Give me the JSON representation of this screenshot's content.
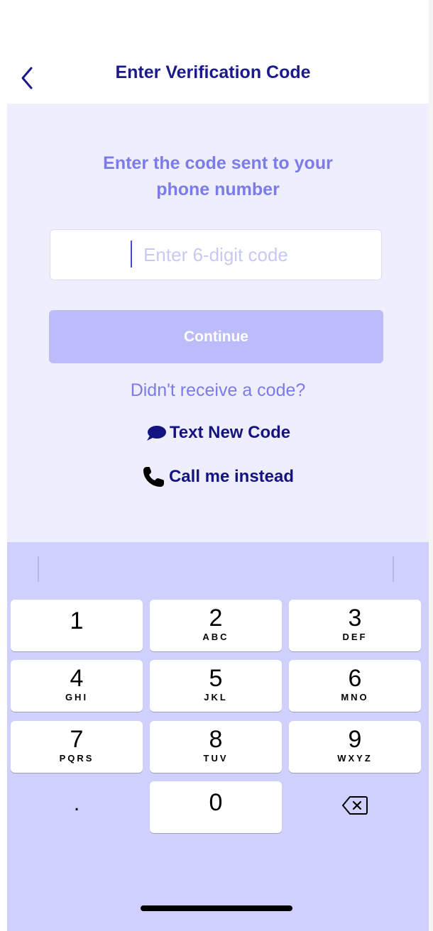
{
  "header": {
    "title": "Enter Verification Code",
    "back_icon": "chevron-left-icon"
  },
  "colors": {
    "title": "#1a1a8c",
    "accent_light": "#7b7bea",
    "content_bg": "#eeeefc",
    "button_disabled": "#bcbcfa",
    "keyboard_bg": "#d0d0fc",
    "link": "#141480"
  },
  "main": {
    "prompt_line1": "Enter the code sent to your",
    "prompt_line2": "phone number",
    "code_input": {
      "placeholder": "Enter 6-digit code",
      "value": ""
    },
    "continue_label": "Continue",
    "no_code_text": "Didn't receive a code?",
    "text_new_code": {
      "label": "Text New Code",
      "icon": "chat-bubble-icon"
    },
    "call_me": {
      "label": "Call me instead",
      "icon": "phone-icon"
    }
  },
  "keyboard": {
    "keys": [
      {
        "num": "1",
        "letters": ""
      },
      {
        "num": "2",
        "letters": "ABC"
      },
      {
        "num": "3",
        "letters": "DEF"
      },
      {
        "num": "4",
        "letters": "GHI"
      },
      {
        "num": "5",
        "letters": "JKL"
      },
      {
        "num": "6",
        "letters": "MNO"
      },
      {
        "num": "7",
        "letters": "PQRS"
      },
      {
        "num": "8",
        "letters": "TUV"
      },
      {
        "num": "9",
        "letters": "WXYZ"
      },
      {
        "num": ".",
        "letters": ""
      },
      {
        "num": "0",
        "letters": ""
      },
      {
        "num": "",
        "letters": "",
        "icon": "backspace-icon"
      }
    ]
  }
}
